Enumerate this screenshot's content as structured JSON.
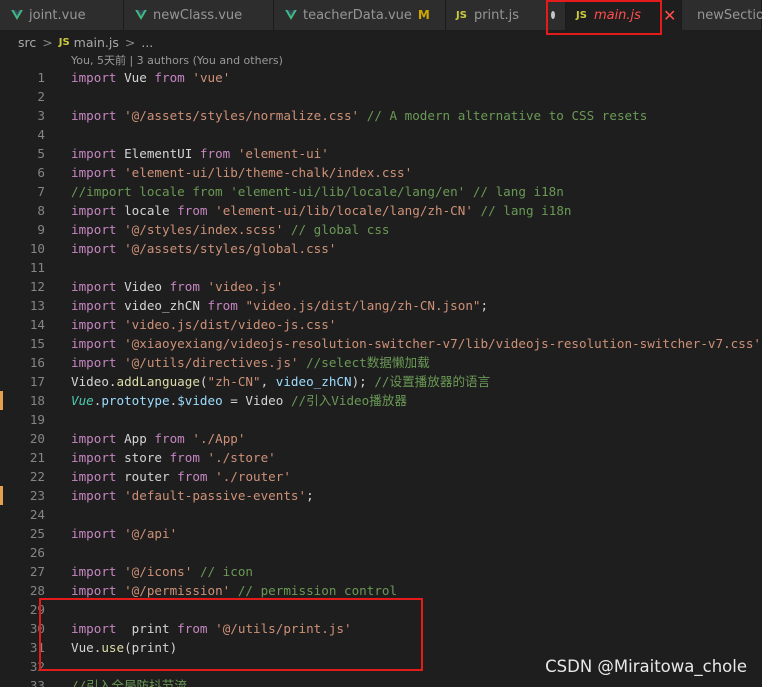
{
  "tabs": [
    {
      "label": "joint.vue",
      "icon": "vue-icon",
      "active": false
    },
    {
      "label": "newClass.vue",
      "icon": "vue-icon",
      "active": false
    },
    {
      "label": "teacherData.vue",
      "icon": "vue-icon",
      "modified": "M",
      "active": false
    },
    {
      "label": "print.js",
      "icon": "js-icon",
      "icon_text": "JS",
      "dirty": true,
      "active": false
    },
    {
      "label": "main.js",
      "icon": "js-icon",
      "icon_text": "JS",
      "active": true,
      "close": "✕"
    },
    {
      "label": "newSection",
      "icon": "vue-icon",
      "active": false
    }
  ],
  "breadcrumb": {
    "folder": "src",
    "sep": ">",
    "js_icon": "JS",
    "file": "main.js",
    "more": "..."
  },
  "codelens": "You, 5天前 | 3 authors (You and others)",
  "watermark": "CSDN @Miraitowa_chole",
  "colors": {
    "accent_highlight": "#e31b1b",
    "active_tab_text": "#ff4d4d",
    "gutter_modified": "#e5a04e"
  },
  "lines": [
    {
      "n": "1",
      "t": [
        [
          "kw",
          "import"
        ],
        [
          "plain",
          " Vue "
        ],
        [
          "kw",
          "from"
        ],
        [
          "plain",
          " "
        ],
        [
          "str",
          "'vue'"
        ]
      ]
    },
    {
      "n": "2",
      "t": []
    },
    {
      "n": "3",
      "t": [
        [
          "kw",
          "import"
        ],
        [
          "plain",
          " "
        ],
        [
          "str",
          "'@/assets/styles/normalize.css'"
        ],
        [
          "plain",
          " "
        ],
        [
          "cm",
          "// A modern alternative to CSS resets"
        ]
      ]
    },
    {
      "n": "4",
      "t": []
    },
    {
      "n": "5",
      "t": [
        [
          "kw",
          "import"
        ],
        [
          "plain",
          " ElementUI "
        ],
        [
          "kw",
          "from"
        ],
        [
          "plain",
          " "
        ],
        [
          "str",
          "'element-ui'"
        ]
      ]
    },
    {
      "n": "6",
      "t": [
        [
          "kw",
          "import"
        ],
        [
          "plain",
          " "
        ],
        [
          "str",
          "'element-ui/lib/theme-chalk/index.css'"
        ]
      ]
    },
    {
      "n": "7",
      "t": [
        [
          "cm",
          "//import locale from 'element-ui/lib/locale/lang/en' // lang i18n"
        ]
      ]
    },
    {
      "n": "8",
      "t": [
        [
          "kw",
          "import"
        ],
        [
          "plain",
          " locale "
        ],
        [
          "kw",
          "from"
        ],
        [
          "plain",
          " "
        ],
        [
          "str",
          "'element-ui/lib/locale/lang/zh-CN'"
        ],
        [
          "plain",
          " "
        ],
        [
          "cm",
          "// lang i18n"
        ]
      ]
    },
    {
      "n": "9",
      "t": [
        [
          "kw",
          "import"
        ],
        [
          "plain",
          " "
        ],
        [
          "str",
          "'@/styles/index.scss'"
        ],
        [
          "plain",
          " "
        ],
        [
          "cm",
          "// global css"
        ]
      ]
    },
    {
      "n": "10",
      "t": [
        [
          "kw",
          "import"
        ],
        [
          "plain",
          " "
        ],
        [
          "str",
          "'@/assets/styles/global.css'"
        ]
      ]
    },
    {
      "n": "11",
      "t": []
    },
    {
      "n": "12",
      "t": [
        [
          "kw",
          "import"
        ],
        [
          "plain",
          " Video "
        ],
        [
          "kw",
          "from"
        ],
        [
          "plain",
          " "
        ],
        [
          "str",
          "'video.js'"
        ]
      ]
    },
    {
      "n": "13",
      "t": [
        [
          "kw",
          "import"
        ],
        [
          "plain",
          " video_zhCN "
        ],
        [
          "kw",
          "from"
        ],
        [
          "plain",
          " "
        ],
        [
          "str",
          "\"video.js/dist/lang/zh-CN.json\""
        ],
        [
          "plain",
          ";"
        ]
      ]
    },
    {
      "n": "14",
      "t": [
        [
          "kw",
          "import"
        ],
        [
          "plain",
          " "
        ],
        [
          "str",
          "'video.js/dist/video-js.css'"
        ]
      ]
    },
    {
      "n": "15",
      "t": [
        [
          "kw",
          "import"
        ],
        [
          "plain",
          " "
        ],
        [
          "str",
          "'@xiaoyexiang/videojs-resolution-switcher-v7/lib/videojs-resolution-switcher-v7.css'"
        ]
      ]
    },
    {
      "n": "16",
      "t": [
        [
          "kw",
          "import"
        ],
        [
          "plain",
          " "
        ],
        [
          "str",
          "'@/utils/directives.js'"
        ],
        [
          "plain",
          " "
        ],
        [
          "cm",
          "//select数据懒加载"
        ]
      ]
    },
    {
      "n": "17",
      "t": [
        [
          "plain",
          "Video."
        ],
        [
          "fn",
          "addLanguage"
        ],
        [
          "plain",
          "("
        ],
        [
          "str",
          "\"zh-CN\""
        ],
        [
          "plain",
          ", "
        ],
        [
          "var",
          "video_zhCN"
        ],
        [
          "plain",
          "); "
        ],
        [
          "cm",
          "//设置播放器的语言"
        ]
      ]
    },
    {
      "n": "18",
      "t": [
        [
          "ty ital",
          "Vue"
        ],
        [
          "plain",
          "."
        ],
        [
          "var",
          "prototype"
        ],
        [
          "plain",
          "."
        ],
        [
          "var",
          "$video"
        ],
        [
          "plain",
          " = Video "
        ],
        [
          "cm",
          "//引入Video播放器"
        ]
      ],
      "mark": true
    },
    {
      "n": "19",
      "t": []
    },
    {
      "n": "20",
      "t": [
        [
          "kw",
          "import"
        ],
        [
          "plain",
          " App "
        ],
        [
          "kw",
          "from"
        ],
        [
          "plain",
          " "
        ],
        [
          "str",
          "'./App'"
        ]
      ]
    },
    {
      "n": "21",
      "t": [
        [
          "kw",
          "import"
        ],
        [
          "plain",
          " store "
        ],
        [
          "kw",
          "from"
        ],
        [
          "plain",
          " "
        ],
        [
          "str",
          "'./store'"
        ]
      ]
    },
    {
      "n": "22",
      "t": [
        [
          "kw",
          "import"
        ],
        [
          "plain",
          " router "
        ],
        [
          "kw",
          "from"
        ],
        [
          "plain",
          " "
        ],
        [
          "str",
          "'./router'"
        ]
      ]
    },
    {
      "n": "23",
      "t": [
        [
          "kw",
          "import"
        ],
        [
          "plain",
          " "
        ],
        [
          "str",
          "'default-passive-events'"
        ],
        [
          "plain",
          ";"
        ]
      ],
      "mark": true
    },
    {
      "n": "24",
      "t": []
    },
    {
      "n": "25",
      "t": [
        [
          "kw",
          "import"
        ],
        [
          "plain",
          " "
        ],
        [
          "str",
          "'@/api'"
        ]
      ]
    },
    {
      "n": "26",
      "t": []
    },
    {
      "n": "27",
      "t": [
        [
          "kw",
          "import"
        ],
        [
          "plain",
          " "
        ],
        [
          "str",
          "'@/icons'"
        ],
        [
          "plain",
          " "
        ],
        [
          "cm",
          "// icon"
        ]
      ]
    },
    {
      "n": "28",
      "t": [
        [
          "kw",
          "import"
        ],
        [
          "plain",
          " "
        ],
        [
          "str",
          "'@/permission'"
        ],
        [
          "plain",
          " "
        ],
        [
          "cm",
          "// permission control"
        ]
      ]
    },
    {
      "n": "29",
      "t": []
    },
    {
      "n": "30",
      "t": [
        [
          "kw",
          "import"
        ],
        [
          "plain",
          "  print "
        ],
        [
          "kw",
          "from"
        ],
        [
          "plain",
          " "
        ],
        [
          "str",
          "'@/utils/print.js'"
        ]
      ]
    },
    {
      "n": "31",
      "t": [
        [
          "plain",
          "Vue."
        ],
        [
          "fn",
          "use"
        ],
        [
          "plain",
          "(print)"
        ]
      ]
    },
    {
      "n": "32",
      "t": []
    },
    {
      "n": "33",
      "t": [
        [
          "cm",
          "//引入全局防抖节流"
        ]
      ]
    }
  ]
}
